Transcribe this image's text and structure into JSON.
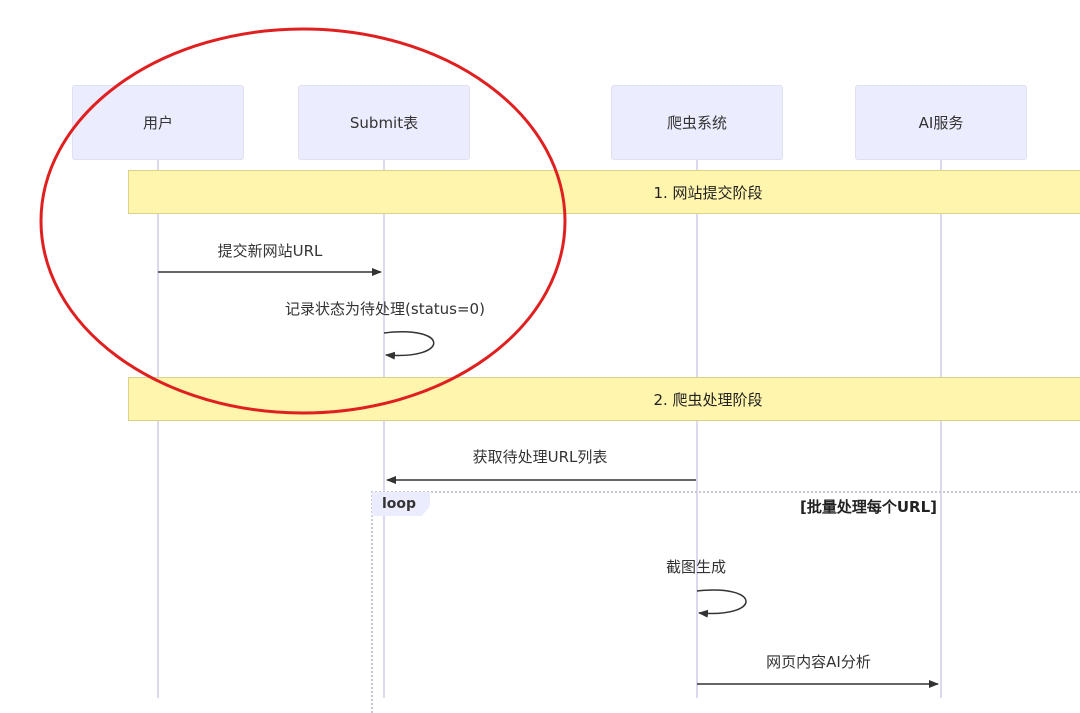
{
  "participants": [
    {
      "id": "user",
      "label": "用户"
    },
    {
      "id": "submit",
      "label": "Submit表"
    },
    {
      "id": "crawler",
      "label": "爬虫系统"
    },
    {
      "id": "ai",
      "label": "AI服务"
    }
  ],
  "notes": [
    {
      "text": "1. 网站提交阶段"
    },
    {
      "text": "2. 爬虫处理阶段"
    }
  ],
  "messages": [
    {
      "from": "user",
      "to": "submit",
      "text": "提交新网站URL"
    },
    {
      "from": "submit",
      "to": "submit",
      "text": "记录状态为待处理(status=0)"
    },
    {
      "from": "crawler",
      "to": "submit",
      "text": "获取待处理URL列表"
    },
    {
      "from": "crawler",
      "to": "crawler",
      "text": "截图生成"
    },
    {
      "from": "crawler",
      "to": "ai",
      "text": "网页内容AI分析"
    }
  ],
  "loop": {
    "tag": "loop",
    "condition": "[批量处理每个URL]"
  },
  "colors": {
    "actor_fill": "#ececff",
    "note_fill": "#fff5ad",
    "highlight_circle": "#e02020",
    "arrow": "#333333"
  }
}
